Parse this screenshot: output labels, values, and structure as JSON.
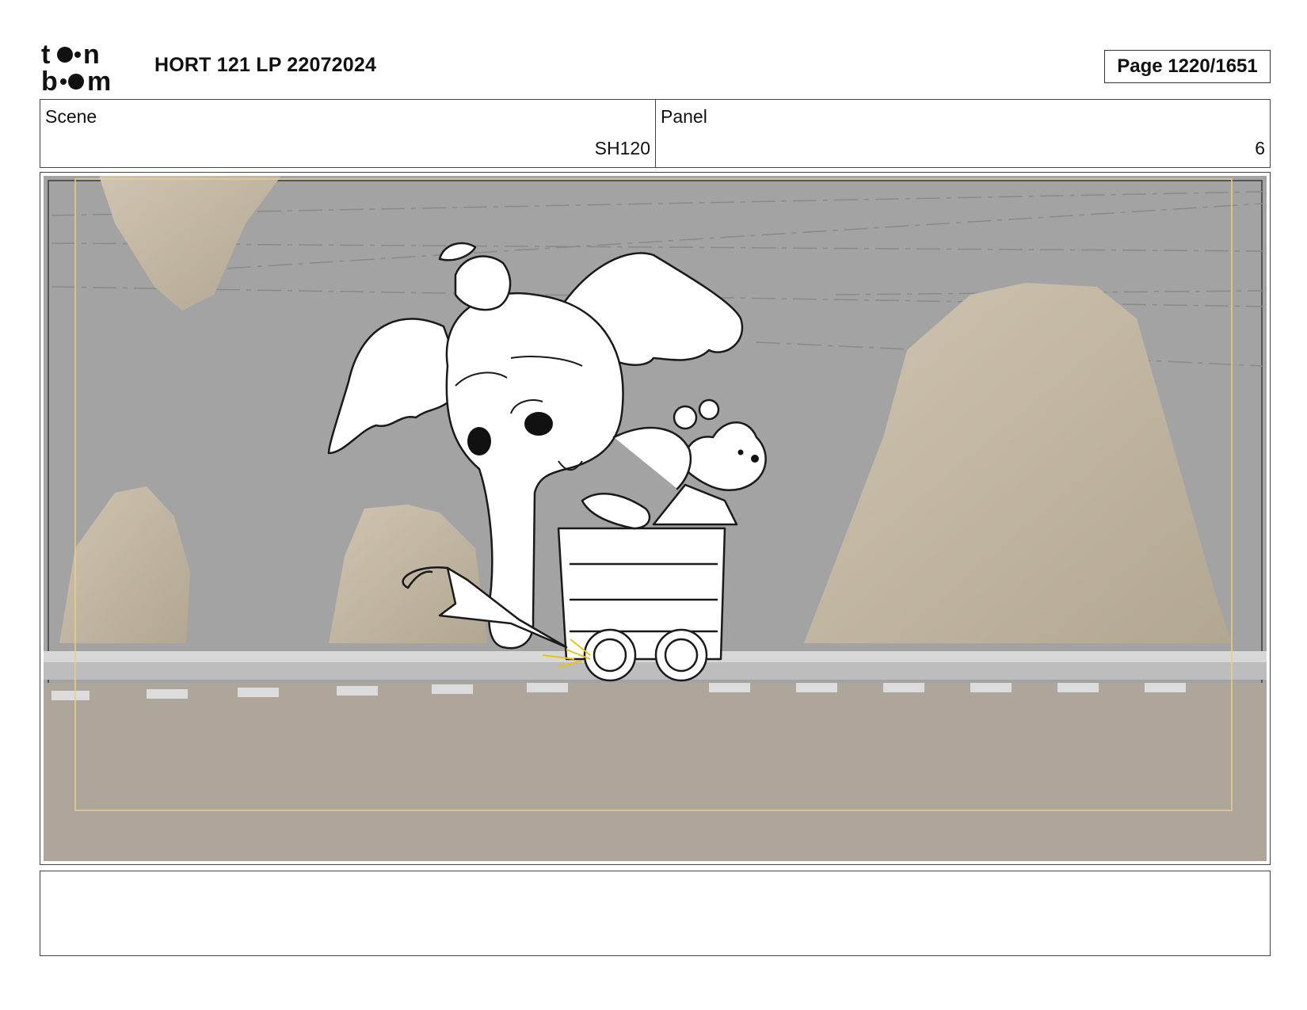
{
  "header": {
    "logo_text_line1": "toon",
    "logo_text_line2": "boom",
    "title": "HORT 121 LP 22072024",
    "page_label": "Page 1220/1651"
  },
  "info": {
    "scene_label": "Scene",
    "scene_value": "SH120",
    "panel_label": "Panel",
    "panel_value": "6"
  },
  "panel_image": {
    "icon": "storyboard-drawing",
    "description_colors": {
      "background": "#a2a2a2",
      "rock": "#c4b8a3",
      "ground": "#aea69b",
      "rail": "#d4d4d4",
      "line": "#1a1a1a"
    }
  },
  "notes": {
    "text": ""
  }
}
